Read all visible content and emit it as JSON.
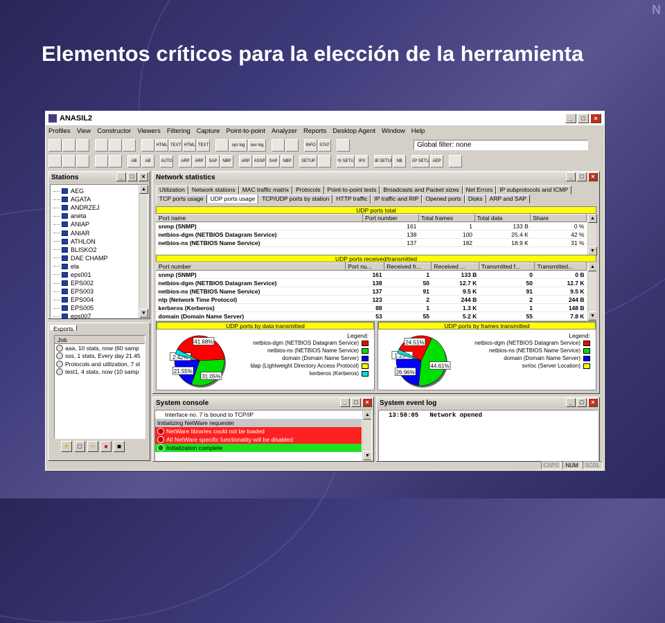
{
  "slide": {
    "title": "Elementos críticos para la elección de la herramienta",
    "corner_mark": "N"
  },
  "app": {
    "title": "ANASIL2",
    "menu": [
      "Profiles",
      "View",
      "Constructor",
      "Viewers",
      "Filtering",
      "Capture",
      "Point-to-point",
      "Analyzer",
      "Reports",
      "Desktop Agent",
      "Window",
      "Help"
    ],
    "toolbar1": [
      "",
      "",
      "",
      "",
      "",
      "",
      "",
      "HTML",
      "TEXT",
      "HTML",
      "TEXT",
      "",
      "sys log",
      "sev log",
      "",
      "",
      "INFO",
      "STAT",
      ""
    ],
    "toolbar2": [
      "",
      "",
      "",
      "",
      "",
      "AB",
      "AB",
      "AUTO",
      "ARP",
      "ARP",
      "SAP",
      "NBP",
      "ARP",
      "ASSP",
      "SAP",
      "NBP",
      "SETUP",
      "",
      "IPX SETUP",
      "IPX",
      "NB SETUP",
      "NB",
      "AEP SETUP",
      "AEP",
      ""
    ],
    "global_filter": "Global filter: none"
  },
  "stations": {
    "title": "Stations",
    "items": [
      "AEG",
      "AGATA",
      "ANDRZEJ",
      "aneta",
      "ANIAP",
      "ANIAR",
      "ATHLON",
      "BLISKO2",
      "DAE CHAMP",
      "ela",
      "eps001",
      "EPS002",
      "EPS003",
      "EPS004",
      "EPS005",
      "eps007"
    ],
    "exports_tab": "Exports",
    "job_header": "Job",
    "jobs": [
      "aaa, 10 stats, now (60 samp",
      "sss, 1 stats, Every day 21.45",
      "Protocols and utilization, 7 st",
      "test1, 4 stats, now (10 samp"
    ]
  },
  "netstats": {
    "title": "Network statistics",
    "tabs_row1": [
      "Utilization",
      "Network stations",
      "MAC traffic matrix",
      "Protocols",
      "Point-to-point tests",
      "Broadcasts and Packet sizes",
      "Net Errors",
      "IP subprotocols and ICMP"
    ],
    "tabs_row2": [
      "TCP ports usage",
      "UDP ports usage",
      "TCP/UDP ports by station",
      "HTTP traffic",
      "IP traffic and RIP",
      "Opened ports",
      "Disks",
      "ARP and SAP"
    ],
    "active_tab": "UDP ports usage",
    "total": {
      "header": "UDP ports total",
      "columns": [
        "Port name",
        "Port number",
        "Total frames",
        "Total data",
        "Share"
      ],
      "rows": [
        [
          "snmp (SNMP)",
          "161",
          "1",
          "133 B",
          "0 %"
        ],
        [
          "netbios-dgm (NETBIOS Datagram Service)",
          "138",
          "100",
          "25.4 K",
          "42 %"
        ],
        [
          "netbios-ns (NETBIOS Name Service)",
          "137",
          "182",
          "18.9 K",
          "31 %"
        ]
      ]
    },
    "rt": {
      "header": "UDP ports received/transmitted",
      "columns": [
        "Port number",
        "Port nu...",
        "Received fr...",
        "Received ...",
        "Transmitted f...",
        "Transmitted..."
      ],
      "rows": [
        [
          "snmp (SNMP)",
          "161",
          "1",
          "133 B",
          "0",
          "0 B"
        ],
        [
          "netbios-dgm (NETBIOS Datagram Service)",
          "138",
          "50",
          "12.7 K",
          "50",
          "12.7 K"
        ],
        [
          "netbios-ns (NETBIOS Name Service)",
          "137",
          "91",
          "9.5 K",
          "91",
          "9.5 K"
        ],
        [
          "ntp (Network Time Protocol)",
          "123",
          "2",
          "244 B",
          "2",
          "244 B"
        ],
        [
          "kerberos (Kerberos)",
          "88",
          "1",
          "1.3 K",
          "1",
          "148 B"
        ],
        [
          "domain (Domain Name Server)",
          "53",
          "55",
          "5.2 K",
          "55",
          "7.8 K"
        ]
      ]
    },
    "pie1": {
      "header": "UDP ports by data transmitted",
      "legend_title": "Legend:",
      "legend": [
        {
          "label": "netbios-dgm (NETBIOS Datagram Service)",
          "color": "#ff0000"
        },
        {
          "label": "netbios-ns (NETBIOS Name Service)",
          "color": "#00e000"
        },
        {
          "label": "domain (Domain Name Server)",
          "color": "#0000ff"
        },
        {
          "label": "ldap (Lightweight Directory Access Protocol)",
          "color": "#ffff00"
        },
        {
          "label": "kerberos (Kerberos)",
          "color": "#00e0e0"
        }
      ],
      "slices": [
        {
          "value": 41.68,
          "label": "41.68%",
          "color": "#ff0000"
        },
        {
          "value": 31.05,
          "label": "31.05%",
          "color": "#00e000"
        },
        {
          "value": 21.55,
          "label": "21.55%",
          "color": "#0000ff"
        },
        {
          "value": 2.42,
          "label": "2.42%",
          "color": "#ffff00"
        },
        {
          "value": 3.3,
          "label": "",
          "color": "#00e0e0"
        }
      ]
    },
    "pie2": {
      "header": "UDP ports by frames transmitted",
      "legend_title": "Legend:",
      "legend": [
        {
          "label": "netbios-dgm (NETBIOS Datagram Service)",
          "color": "#ff0000"
        },
        {
          "label": "netbios-ns (NETBIOS Name Service)",
          "color": "#00e000"
        },
        {
          "label": "domain (Domain Name Server)",
          "color": "#0000ff"
        },
        {
          "label": "svrloc (Server Location)",
          "color": "#ffff00"
        }
      ],
      "slices": [
        {
          "value": 24.51,
          "label": "24.51%",
          "color": "#ff0000"
        },
        {
          "value": 44.61,
          "label": "44.61%",
          "color": "#00e000"
        },
        {
          "value": 26.96,
          "label": "26.96%",
          "color": "#0000ff"
        },
        {
          "value": 1.23,
          "label": "1.23%",
          "color": "#ffff00"
        },
        {
          "value": 2.69,
          "label": "",
          "color": "#00e0e0"
        }
      ]
    }
  },
  "console": {
    "title": "System console",
    "lines": [
      {
        "text": "Interface no. 7 is bound to TCP/IP",
        "bg": "#ffffff",
        "icon": ""
      },
      {
        "text": "Initializing NetWare requester",
        "bg": "#c8c8c8",
        "icon": ""
      },
      {
        "text": "NetWare libraries could not be loaded",
        "bg": "#ff2020",
        "icon": "stop"
      },
      {
        "text": "All NetWare specific functionality will be disabled",
        "bg": "#ff2020",
        "icon": "stop"
      },
      {
        "text": "Initialization complete",
        "bg": "#20e020",
        "icon": "ok"
      }
    ]
  },
  "eventlog": {
    "title": "System event log",
    "entries": [
      "13:50:05   Network opened"
    ]
  },
  "statusbar": [
    "CAPS",
    "NUM",
    "SCRL"
  ],
  "statusbar_active": "NUM"
}
